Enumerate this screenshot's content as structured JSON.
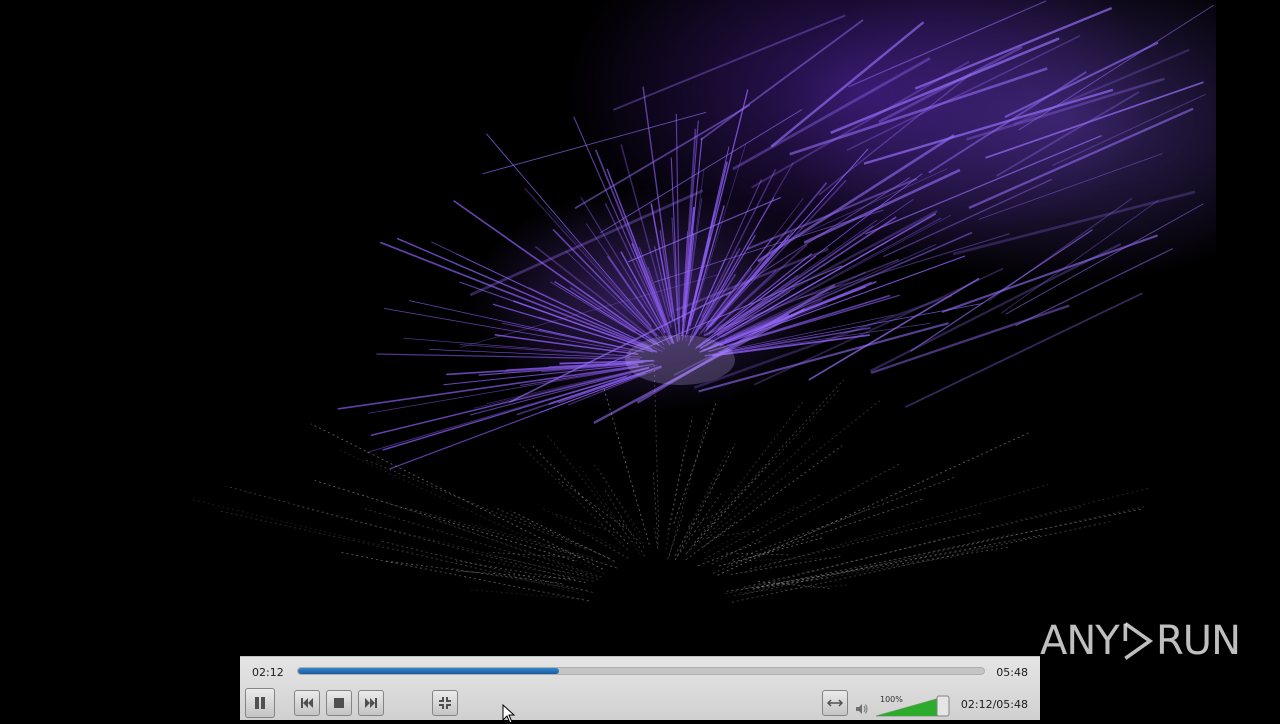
{
  "player": {
    "elapsed": "02:12",
    "total": "05:48",
    "status_time": "02:12/05:48",
    "progress_fraction": 0.38,
    "volume_label": "100%",
    "volume_fraction": 1.0
  },
  "watermark": {
    "left": "ANY",
    "right": "RUN"
  },
  "icons": {
    "pause": "pause-icon",
    "previous": "skip-previous-icon",
    "stop": "stop-icon",
    "next": "skip-next-icon",
    "fullscreen": "fullscreen-icon",
    "aspect": "aspect-ratio-icon",
    "volume": "speaker-icon"
  },
  "colors": {
    "seek_fill": "#1d5fa8",
    "volume_fill": "#2fb52f",
    "visual_accent": "#8a5cf0"
  }
}
